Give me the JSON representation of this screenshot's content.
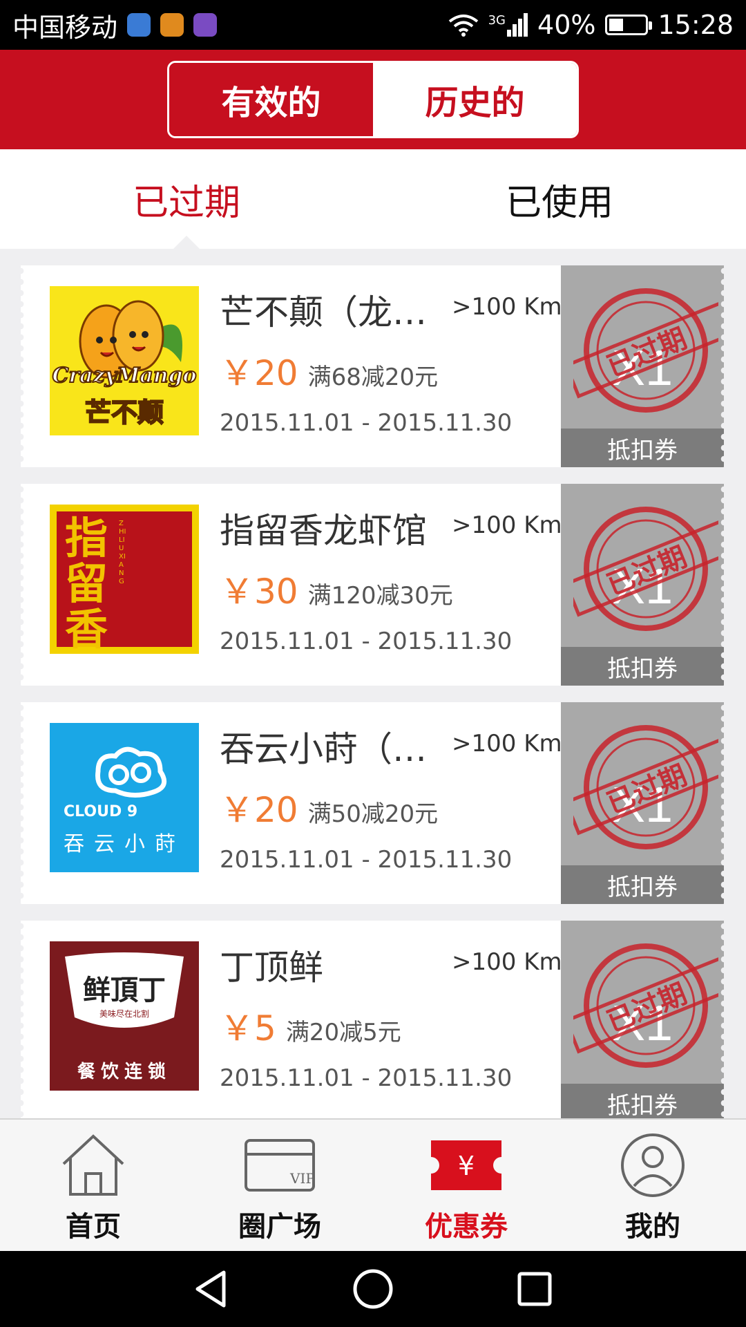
{
  "status_bar": {
    "carrier": "中国移动",
    "network": "3G",
    "battery": "40%",
    "battery_level": 0.4,
    "time": "15:28"
  },
  "header": {
    "segments": [
      {
        "label": "有效的",
        "active": true
      },
      {
        "label": "历史的",
        "active": false
      }
    ]
  },
  "sub_tabs": [
    {
      "label": "已过期",
      "active": true
    },
    {
      "label": "已使用",
      "active": false
    }
  ],
  "coupons": [
    {
      "logo_text": "CrazyMango",
      "logo_subtext": "芒不颠",
      "title": "芒不颠（龙…",
      "distance": ">100 Km",
      "price": "￥20",
      "condition": "满68减20元",
      "dates": "2015.11.01 - 2015.11.30",
      "stamp": "已过期",
      "quantity": "X1",
      "type": "抵扣券"
    },
    {
      "logo_text": "指留香",
      "logo_subtext": "ZHI LIU XIANG",
      "title": "指留香龙虾馆",
      "distance": ">100 Km",
      "price": "￥30",
      "condition": "满120减30元",
      "dates": "2015.11.01 - 2015.11.30",
      "stamp": "已过期",
      "quantity": "X1",
      "type": "抵扣券"
    },
    {
      "logo_text": "CLOUD 9",
      "logo_subtext": "吞云小莳",
      "title": "吞云小莳（…",
      "distance": ">100 Km",
      "price": "￥20",
      "condition": "满50减20元",
      "dates": "2015.11.01 - 2015.11.30",
      "stamp": "已过期",
      "quantity": "X1",
      "type": "抵扣券"
    },
    {
      "logo_text": "鲜頂丁",
      "logo_subtext": "美味尽在北割",
      "logo_footer": "餐饮连锁",
      "title": "丁顶鲜",
      "distance": ">100 Km",
      "price": "￥5",
      "condition": "满20减5元",
      "dates": "2015.11.01 - 2015.11.30",
      "stamp": "已过期",
      "quantity": "X1",
      "type": "抵扣券"
    }
  ],
  "bottom_nav": [
    {
      "label": "首页",
      "icon": "home-icon",
      "active": false
    },
    {
      "label": "圈广场",
      "icon": "vip-card-icon",
      "active": false
    },
    {
      "label": "优惠券",
      "icon": "coupon-icon",
      "active": true,
      "icon_text": "¥"
    },
    {
      "label": "我的",
      "icon": "profile-icon",
      "active": false
    }
  ],
  "badge_text": "VIP",
  "colors": {
    "brand_red": "#c60f1f",
    "price_orange": "#f07c34",
    "active_nav": "#d8101d"
  }
}
